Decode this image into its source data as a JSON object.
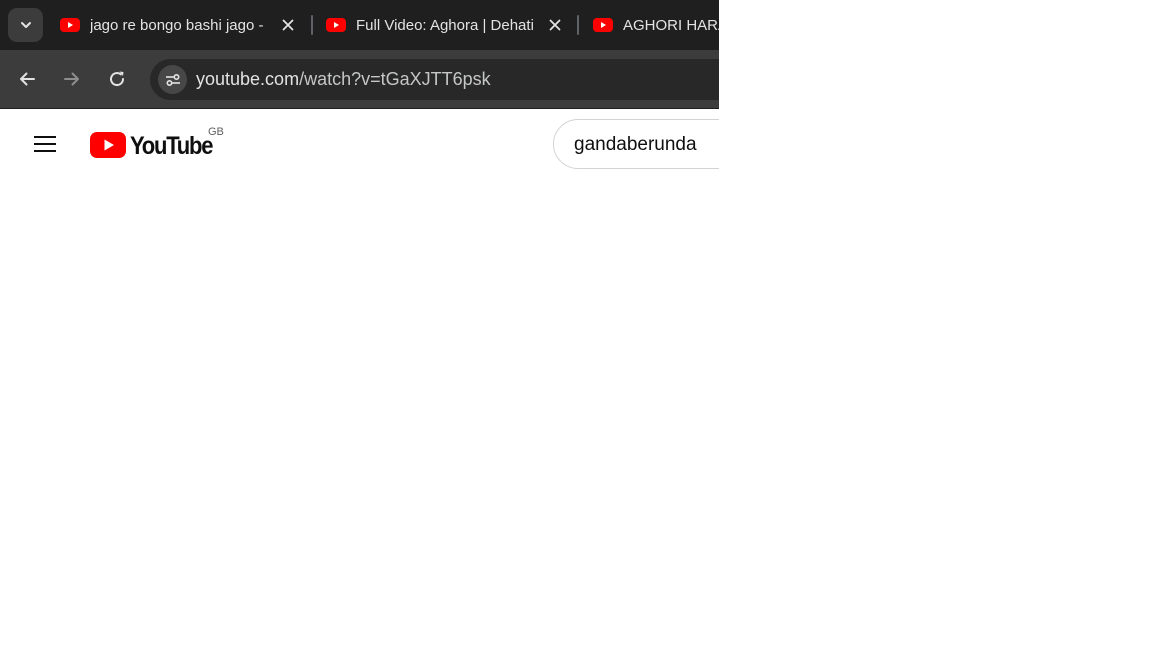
{
  "browser": {
    "tabs": [
      {
        "title": "jago re bongo bashi jago -",
        "icon": "youtube-favicon"
      },
      {
        "title": "Full Video: Aghora | Dehati",
        "icon": "youtube-favicon"
      },
      {
        "title": "AGHORI HARA",
        "icon": "youtube-favicon"
      }
    ],
    "address_bar": {
      "domain": "youtube.com",
      "path": "/watch?v=tGaXJTT6psk"
    }
  },
  "youtube": {
    "logo_text": "YouTube",
    "region": "GB",
    "search": {
      "value": "gandaberunda"
    }
  },
  "colors": {
    "brand_red": "#ff0000",
    "chrome_dark": "#1f1f1f",
    "toolbar": "#3c3c3c"
  }
}
